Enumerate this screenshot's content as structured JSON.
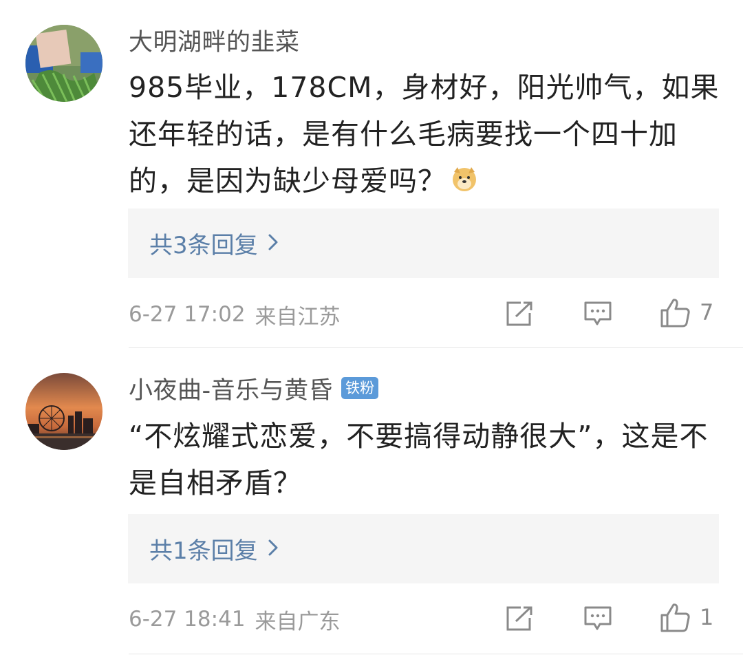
{
  "comments": [
    {
      "username": "大明湖畔的韭菜",
      "badge": "",
      "text": "985毕业，178CM，身材好，阳光帅气，如果还年轻的话，是有什么毛病要找一个四十加的，是因为缺少母爱吗？",
      "emoji_icon": "doge-emoji-icon",
      "replies_label": "共3条回复",
      "date": "6-27 17:02",
      "location": "来自江苏",
      "like_count": "7"
    },
    {
      "username": "小夜曲-音乐与黄昏",
      "badge": "铁粉",
      "text": "“不炫耀式恋爱，不要搞得动静很大”，这是不是自相矛盾？",
      "replies_label": "共1条回复",
      "date": "6-27 18:41",
      "location": "来自广东",
      "like_count": "1"
    }
  ],
  "colors": {
    "username": "#555555",
    "body_text": "#222222",
    "reply_link": "#5b7fa8",
    "meta": "#9a9a9a",
    "badge_bg": "#5b9ad9",
    "reply_box_bg": "#f5f5f5"
  },
  "icons": [
    "share-icon",
    "comment-icon",
    "like-icon",
    "chevron-right-icon"
  ]
}
